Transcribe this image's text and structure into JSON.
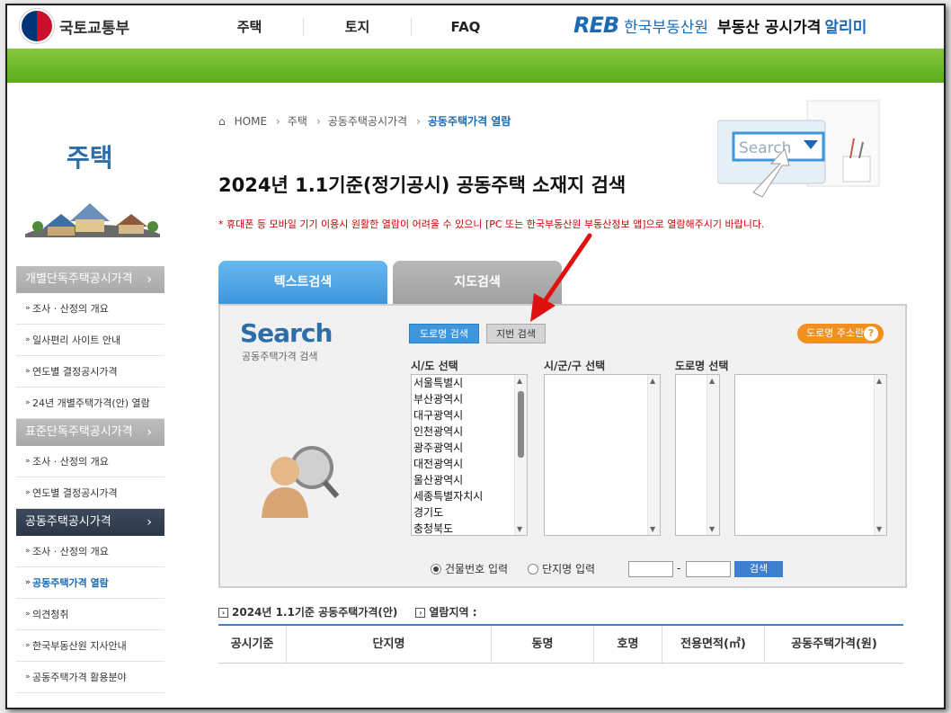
{
  "header": {
    "ministry": "국토교통부",
    "nav": [
      "주택",
      "토지",
      "FAQ"
    ],
    "reb_mark": "REB",
    "reb_name": "한국부동산원",
    "alimi_part1": "부동산 공시가격",
    "alimi_part2": "알리미"
  },
  "sidebar": {
    "title": "주택",
    "groups": [
      {
        "label": "개별단독주택공시가격",
        "items": [
          "조사 · 산정의 개요",
          "일사편리 사이트 안내",
          "연도별 결정공시가격",
          "24년 개별주택가격(안) 열람"
        ]
      },
      {
        "label": "표준단독주택공시가격",
        "items": [
          "조사 · 산정의 개요",
          "연도별 결정공시가격"
        ]
      },
      {
        "label": "공동주택공시가격",
        "items": [
          "조사 · 산정의 개요",
          "공동주택가격 열람",
          "의견청취",
          "한국부동산원 지사안내",
          "공동주택가격 활용분야"
        ]
      }
    ],
    "current_item": "공동주택가격 열람"
  },
  "breadcrumb": [
    "HOME",
    "주택",
    "공동주택공시가격",
    "공동주택가격 열람"
  ],
  "page_title": "2024년 1.1기준(정기공시) 공동주택 소재지 검색",
  "notice": "* 휴대폰 등 모바일 기기 이용시 원활한 열람이 어려울 수 있으니 [PC 또는 한국부동산원 부동산정보 앱]으로 열람해주시기 바랍니다.",
  "hero_text": "Search",
  "tabs": [
    "텍스트검색",
    "지도검색"
  ],
  "search_panel": {
    "logo": "Search",
    "logo_sub": "공동주택가격 검색",
    "btn_road": "도로명 검색",
    "btn_jibun": "지번 검색",
    "btn_guide": "도로명 주소란",
    "guide_icon": "?",
    "col_sido": "시/도 선택",
    "col_sigungu": "시/군/구 선택",
    "col_road": "도로명 선택",
    "sido_options": [
      "서울특별시",
      "부산광역시",
      "대구광역시",
      "인천광역시",
      "광주광역시",
      "대전광역시",
      "울산광역시",
      "세종특별자치시",
      "경기도",
      "충청북도"
    ],
    "radio_building": "건물번호 입력",
    "radio_complex": "단지명 입력",
    "dash": "-",
    "btn_search": "검색"
  },
  "result": {
    "info_1": "2024년 1.1기준 공동주택가격(안)",
    "info_2": "열람지역 :",
    "columns": [
      "공시기준",
      "단지명",
      "동명",
      "호명",
      "전용면적(㎡)",
      "공동주택가격(원)"
    ]
  },
  "colors": {
    "accent": "#3e96dc",
    "green": "#6bb82a",
    "arrow": "#e01010"
  }
}
